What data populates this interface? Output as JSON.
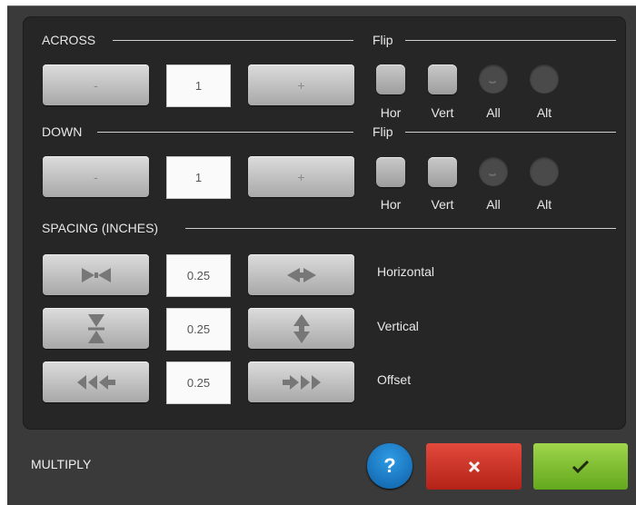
{
  "across": {
    "label": "ACROSS",
    "minus_label": "-",
    "plus_label": "+",
    "value": "1",
    "flip_label": "Flip",
    "flip_options": [
      "Hor",
      "Vert",
      "All",
      "Alt"
    ]
  },
  "down": {
    "label": "DOWN",
    "minus_label": "-",
    "plus_label": "+",
    "value": "1",
    "flip_label": "Flip",
    "flip_options": [
      "Hor",
      "Vert",
      "All",
      "Alt"
    ]
  },
  "spacing": {
    "label": "SPACING (INCHES)",
    "rows": [
      {
        "label": "Horizontal",
        "value": "0.25",
        "decrease_icon": "arrows-inward-horizontal-icon",
        "increase_icon": "arrows-outward-horizontal-icon"
      },
      {
        "label": "Vertical",
        "value": "0.25",
        "decrease_icon": "arrows-inward-vertical-icon",
        "increase_icon": "arrows-outward-vertical-icon"
      },
      {
        "label": "Offset",
        "value": "0.25",
        "decrease_icon": "triple-arrow-left-icon",
        "increase_icon": "triple-arrow-right-icon"
      }
    ]
  },
  "footer": {
    "title": "MULTIPLY",
    "help_label": "?",
    "cancel_icon": "close-x-icon",
    "ok_icon": "checkmark-icon"
  },
  "colors": {
    "help": "#1a78c2",
    "cancel": "#cc3326",
    "ok": "#7cbd30"
  }
}
